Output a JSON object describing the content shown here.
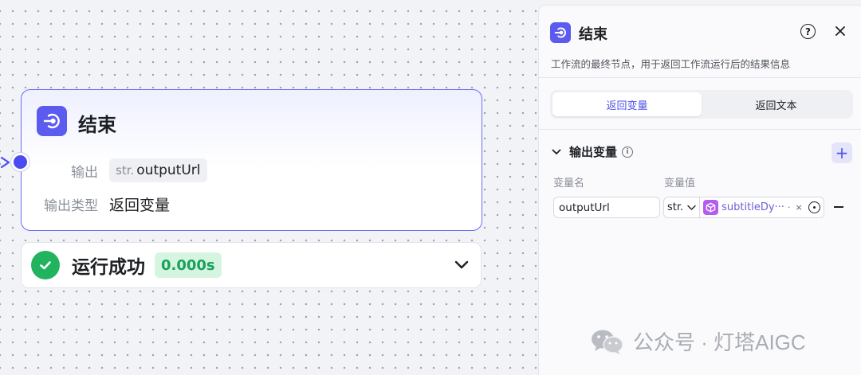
{
  "node": {
    "title": "结束",
    "output_label": "输出",
    "output_type": "str.",
    "output_var": "outputUrl",
    "output_type_label": "输出类型",
    "output_type_value": "返回变量"
  },
  "status": {
    "text": "运行成功",
    "time": "0.000s"
  },
  "panel": {
    "title": "结束",
    "help": "?",
    "description": "工作流的最终节点，用于返回工作流运行后的结果信息",
    "tabs": [
      {
        "label": "返回变量",
        "active": true
      },
      {
        "label": "返回文本",
        "active": false
      }
    ],
    "section_title": "输出变量",
    "col_name": "变量名",
    "col_value": "变量值",
    "var_name": "outputUrl",
    "var_type": "str.",
    "var_ref": "subtitleDy···",
    "var_ref_dot": "·",
    "var_ref_close": "×"
  },
  "watermark": {
    "text": "公众号 · 灯塔AIGC"
  },
  "colors": {
    "accent": "#5b5bf0",
    "success": "#22b35e",
    "ref_tag": "#b55cf0"
  }
}
